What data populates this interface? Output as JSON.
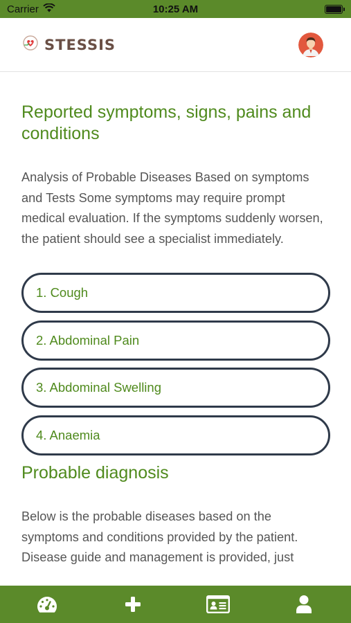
{
  "status_bar": {
    "carrier": "Carrier",
    "time": "10:25 AM",
    "battery_level": 1.0
  },
  "header": {
    "brand_name": "STESSIS",
    "logo_icon": "heart-medical-logo",
    "avatar_icon": "user-avatar"
  },
  "content": {
    "title": "Reported symptoms, signs, pains and conditions",
    "description": "Analysis of Probable Diseases Based on symptoms and Tests Some symptoms may require prompt medical evaluation. If the symptoms suddenly worsen, the patient should see a specialist immediately.",
    "symptoms": [
      {
        "label": "1. Cough"
      },
      {
        "label": "2. Abdominal Pain"
      },
      {
        "label": "3. Abdominal Swelling"
      },
      {
        "label": "4. Anaemia"
      }
    ],
    "diagnosis_title": "Probable diagnosis",
    "diagnosis_text": "Below is the probable diseases based on the symptoms and conditions provided by the patient. Disease guide and management is provided, just"
  },
  "tab_bar": {
    "tabs": [
      {
        "icon": "dashboard-gauge-icon"
      },
      {
        "icon": "plus-icon"
      },
      {
        "icon": "id-card-icon"
      },
      {
        "icon": "user-icon"
      }
    ]
  },
  "colors": {
    "brand_green": "#5b8a2a",
    "heading_green": "#4f8a1d",
    "pill_border": "#2f3a4a",
    "body_text": "#555555"
  }
}
